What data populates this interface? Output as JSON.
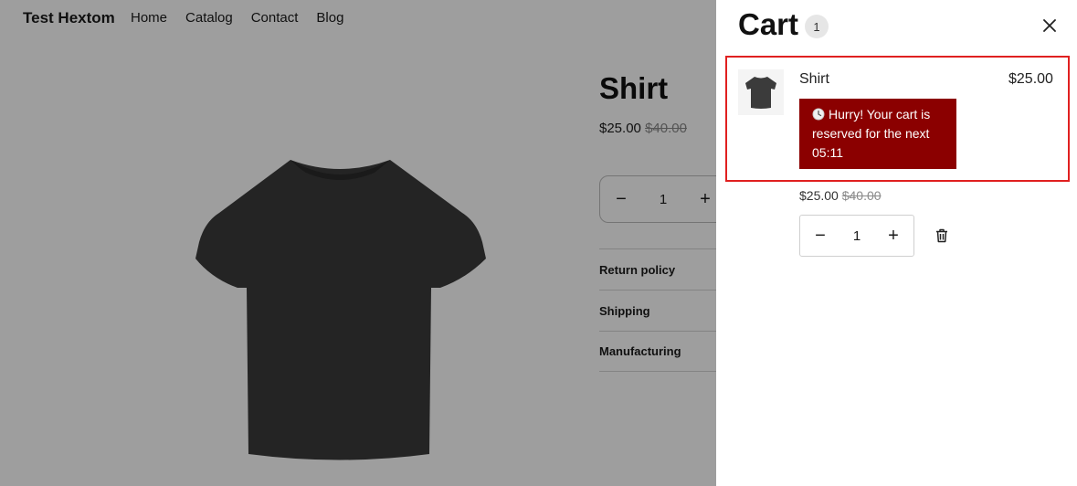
{
  "header": {
    "brand": "Test Hextom",
    "nav": [
      "Home",
      "Catalog",
      "Contact",
      "Blog"
    ]
  },
  "product": {
    "title": "Shirt",
    "price": "$25.00",
    "compare_price": "$40.00",
    "quantity": "1",
    "accordion": [
      "Return policy",
      "Shipping",
      "Manufacturing"
    ],
    "image_icon": "tshirt-image"
  },
  "cart": {
    "title": "Cart",
    "count": "1",
    "item": {
      "name": "Shirt",
      "line_price": "$25.00",
      "timer_message": "Hurry! Your cart is reserved for the next 05:11",
      "price": "$25.00",
      "compare_price": "$40.00",
      "quantity": "1"
    }
  },
  "colors": {
    "timer_bg": "#8b0000",
    "highlight_border": "#e02020",
    "overlay": "rgba(0,0,0,0.38)"
  }
}
